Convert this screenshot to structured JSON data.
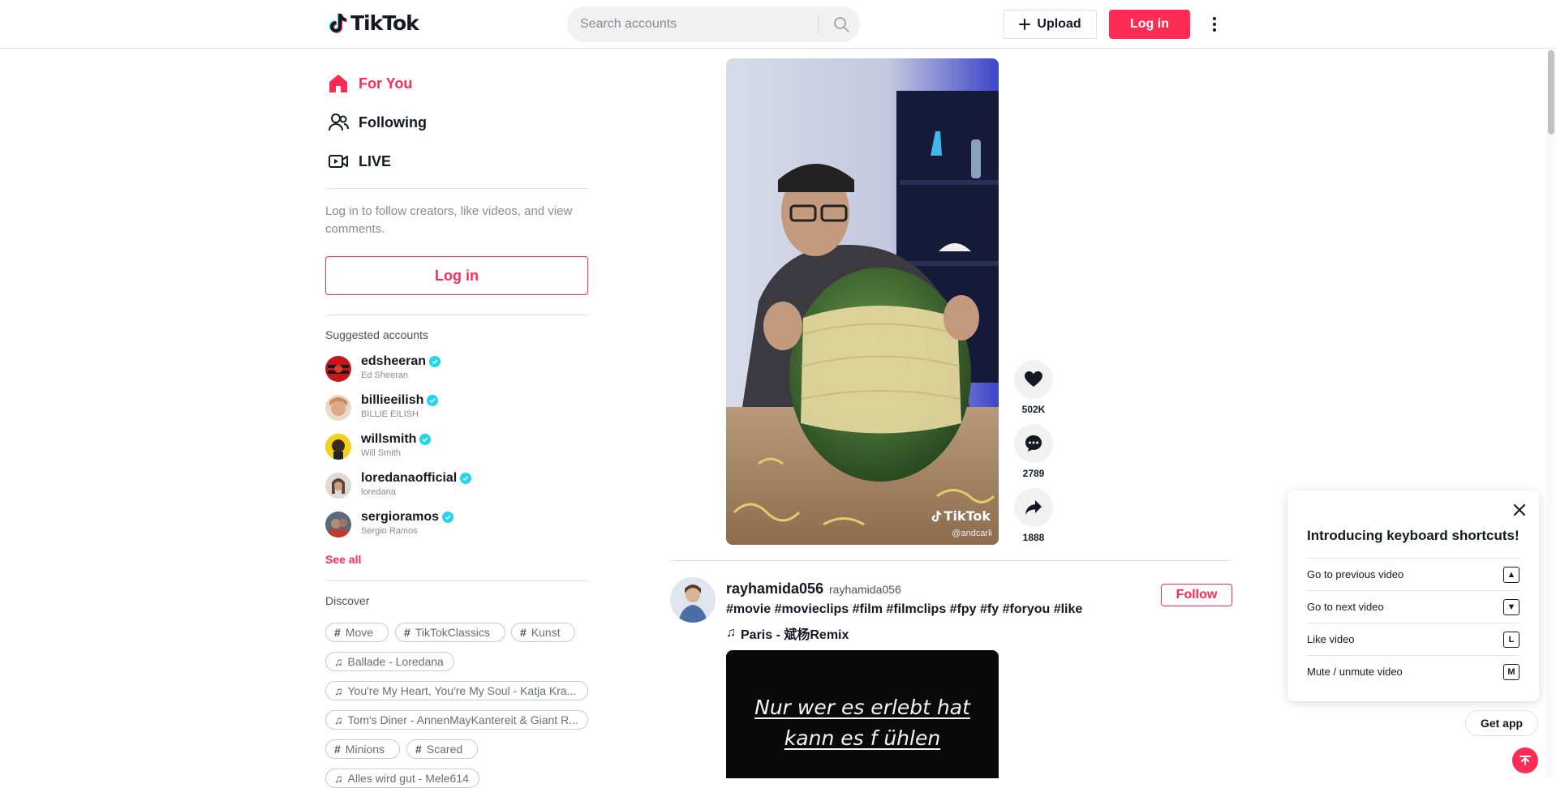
{
  "header": {
    "logo_text": "TikTok",
    "search_placeholder": "Search accounts",
    "upload_label": "Upload",
    "login_label": "Log in"
  },
  "sidebar": {
    "nav": [
      {
        "label": "For You",
        "icon": "home-icon",
        "active": true
      },
      {
        "label": "Following",
        "icon": "people-icon",
        "active": false
      },
      {
        "label": "LIVE",
        "icon": "live-camera-icon",
        "active": false
      }
    ],
    "login_prompt": "Log in to follow creators, like videos, and view comments.",
    "login_button": "Log in",
    "suggested_title": "Suggested accounts",
    "accounts": [
      {
        "username": "edsheeran",
        "display_name": "Ed Sheeran"
      },
      {
        "username": "billieeilish",
        "display_name": "BILLIE EILISH"
      },
      {
        "username": "willsmith",
        "display_name": "Will Smith"
      },
      {
        "username": "loredanaofficial",
        "display_name": "loredana"
      },
      {
        "username": "sergioramos",
        "display_name": "Sergio Ramos"
      }
    ],
    "see_all": "See all",
    "discover_title": "Discover",
    "tags": [
      {
        "type": "hashtag",
        "label": "Move"
      },
      {
        "type": "hashtag",
        "label": "TikTokClassics"
      },
      {
        "type": "hashtag",
        "label": "Kunst"
      },
      {
        "type": "music",
        "label": "Ballade - Loredana"
      },
      {
        "type": "music",
        "label": "You're My Heart, You're My Soul - Katja Kra..."
      },
      {
        "type": "music",
        "label": "Tom's Diner - AnnenMayKantereit & Giant R..."
      },
      {
        "type": "hashtag",
        "label": "Minions"
      },
      {
        "type": "hashtag",
        "label": "Scared"
      },
      {
        "type": "music",
        "label": "Alles wird gut - Mele614"
      }
    ]
  },
  "feed": {
    "video1": {
      "watermark": "TikTok",
      "watermark_user": "@andcarli",
      "likes": "502K",
      "comments": "2789",
      "shares": "1888"
    },
    "post2": {
      "username": "rayhamida056",
      "nickname": "rayhamida056",
      "caption": "#movie #movieclips #film #filmclips #fpy #fy #foryou #like",
      "music": "Paris - 斌杨Remix",
      "follow_label": "Follow",
      "overlay_line1": "Nur wer es erlebt hat",
      "overlay_line2": "kann es f ühlen"
    }
  },
  "shortcuts": {
    "title": "Introducing keyboard shortcuts!",
    "items": [
      {
        "label": "Go to previous video",
        "key": "▲"
      },
      {
        "label": "Go to next video",
        "key": "▼"
      },
      {
        "label": "Like video",
        "key": "L"
      },
      {
        "label": "Mute / unmute video",
        "key": "M"
      }
    ]
  },
  "get_app": "Get app",
  "colors": {
    "brand": "#fe2c55",
    "verified": "#20d5ec"
  }
}
